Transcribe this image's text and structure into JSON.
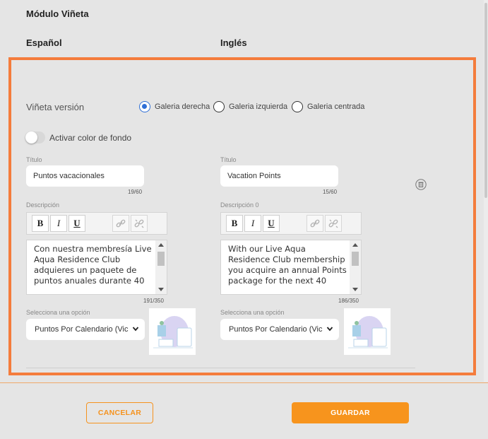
{
  "module_title": "Módulo Viñeta",
  "columns": {
    "spanish": "Español",
    "english": "Inglés"
  },
  "version": {
    "label": "Viñeta versión",
    "options": [
      {
        "label": "Galeria derecha",
        "selected": true
      },
      {
        "label": "Galeria izquierda",
        "selected": false
      },
      {
        "label": "Galeria centrada",
        "selected": false
      }
    ]
  },
  "background_toggle": {
    "label": "Activar color de fondo",
    "on": false
  },
  "spanish": {
    "title_label": "Título",
    "title_value": "Puntos vacacionales",
    "title_counter": "19/60",
    "description_label": "Descripción",
    "description_text": "Con nuestra membresía Live Aqua Residence Club adquieres un paquete de puntos anuales durante 40",
    "description_counter": "191/350",
    "select_label": "Selecciona una opción",
    "select_value": "Puntos Por Calendario (Vic"
  },
  "english": {
    "title_label": "Título",
    "title_value": "Vacation Points",
    "title_counter": "15/60",
    "description_label": "Descripción 0",
    "description_text": "With our Live Aqua Residence Club membership you acquire an annual Points package for the next 40",
    "description_counter": "186/350",
    "select_label": "Selecciona una opción",
    "select_value": "Puntos Por Calendario (Vic"
  },
  "toolbar": {
    "bold": "B",
    "italic": "I",
    "underline": "U"
  },
  "icons": {
    "delete": "trash-icon",
    "link": "link-icon",
    "unlink": "unlink-icon",
    "dropdown": "chevron-down-icon"
  },
  "actions": {
    "cancel": "CANCELAR",
    "save": "GUARDAR"
  },
  "colors": {
    "accent": "#f5921e",
    "frame": "#f47c3c",
    "radio": "#2f6fd6"
  }
}
